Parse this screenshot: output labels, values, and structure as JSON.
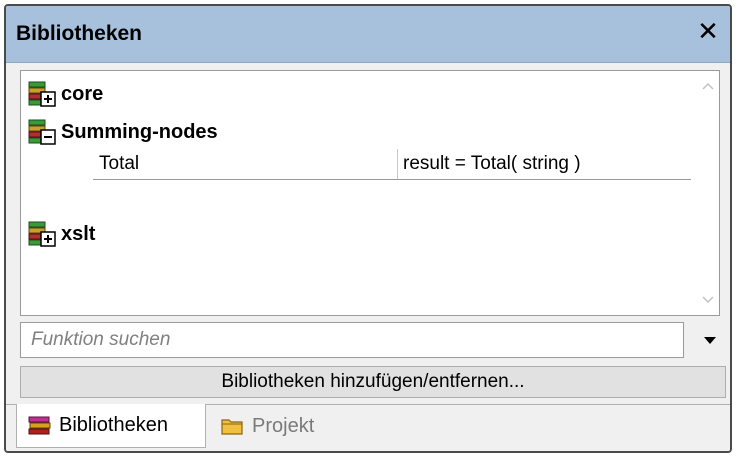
{
  "window": {
    "title": "Bibliotheken",
    "close_label": "✕"
  },
  "libraries": [
    {
      "name": "core",
      "state": "collapsed",
      "icon": "library-plus-icon"
    },
    {
      "name": "Summing-nodes",
      "state": "expanded",
      "icon": "library-minus-icon",
      "functions": [
        {
          "name": "Total",
          "signature": "result = Total( string )"
        }
      ]
    },
    {
      "name": "xslt",
      "state": "collapsed",
      "icon": "library-plus-icon"
    }
  ],
  "search": {
    "placeholder": "Funktion suchen",
    "value": ""
  },
  "add_remove_button": {
    "label": "Bibliotheken hinzufügen/entfernen..."
  },
  "tabs": [
    {
      "label": "Bibliotheken",
      "active": true,
      "icon": "books-icon"
    },
    {
      "label": "Projekt",
      "active": false,
      "icon": "folder-icon"
    }
  ],
  "colors": {
    "titlebar": "#a7c0dc",
    "panel_bg": "#f0f0f0",
    "inactive_text": "#7a7a7a"
  }
}
